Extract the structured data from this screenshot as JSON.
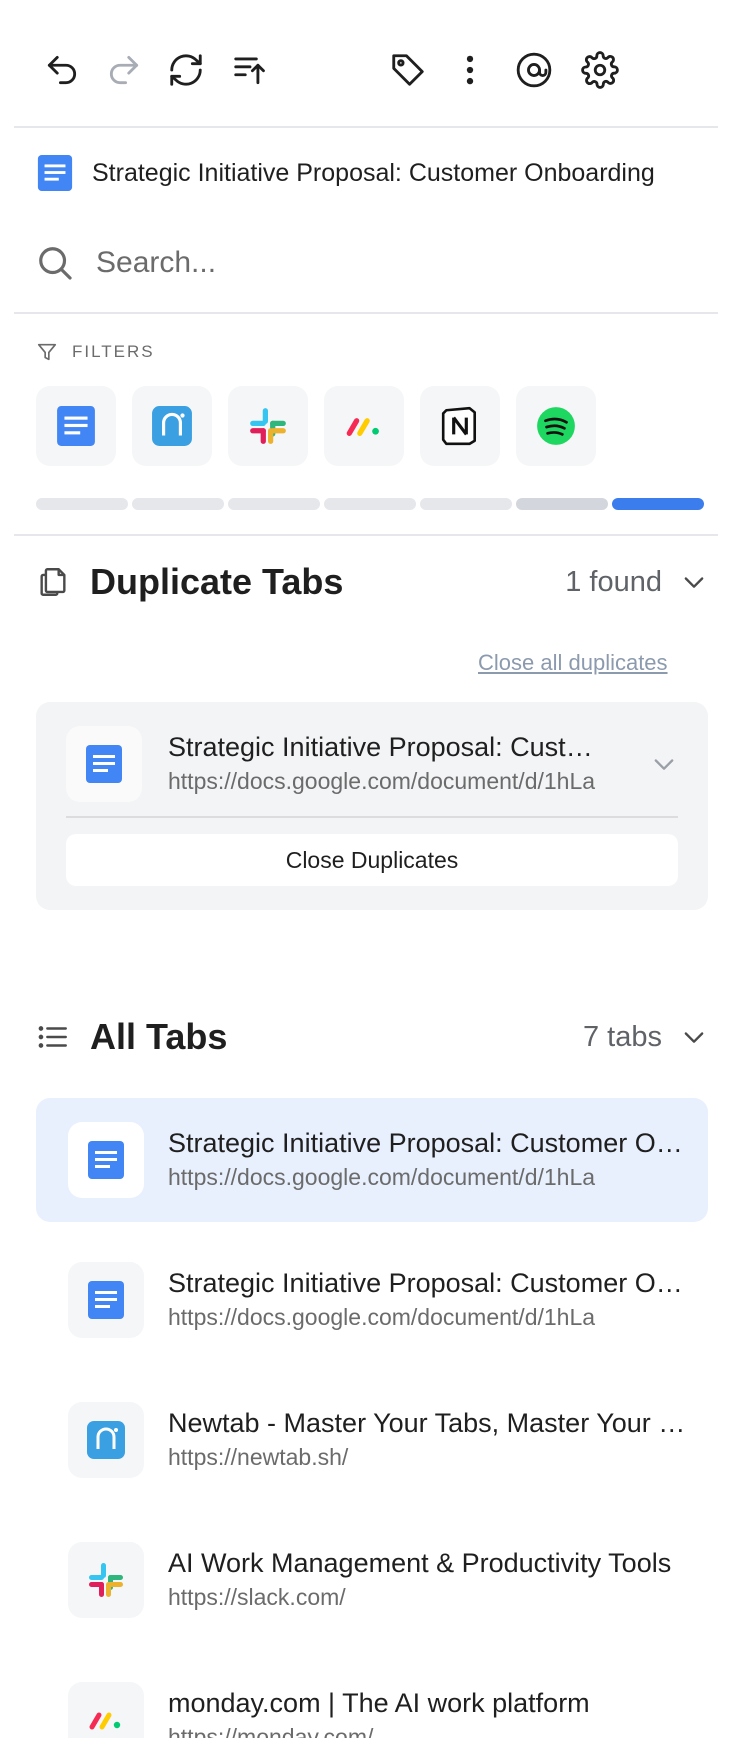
{
  "toolbar": {
    "buttons": [
      {
        "name": "undo-icon",
        "label": "Undo"
      },
      {
        "name": "redo-icon",
        "label": "Redo"
      },
      {
        "name": "refresh-icon",
        "label": "Refresh"
      },
      {
        "name": "sort-icon",
        "label": "Sort"
      },
      {
        "name": "tag-icon",
        "label": "Tags"
      },
      {
        "name": "more-vertical-icon",
        "label": "More"
      },
      {
        "name": "at-sign-icon",
        "label": "Mentions"
      },
      {
        "name": "gear-icon",
        "label": "Settings"
      }
    ]
  },
  "current_tab": {
    "title": "Strategic Initiative Proposal: Customer Onboarding",
    "icon": "google-docs-icon"
  },
  "search": {
    "placeholder": "Search...",
    "value": ""
  },
  "filters": {
    "label": "FILTERS",
    "chips": [
      {
        "icon": "google-docs-icon"
      },
      {
        "icon": "newtab-icon"
      },
      {
        "icon": "slack-icon"
      },
      {
        "icon": "monday-icon"
      },
      {
        "icon": "notion-icon"
      },
      {
        "icon": "spotify-icon"
      }
    ],
    "progress_segments": 7,
    "active_segment": 7,
    "colors": {
      "inactive": "#e5e7eb",
      "secondary": "#d3d6dc",
      "active": "#3b7ded"
    }
  },
  "duplicates": {
    "title": "Duplicate Tabs",
    "count": "1 found",
    "close_all_label": "Close all duplicates",
    "items": [
      {
        "title": "Strategic Initiative Proposal: Customer Onboarding",
        "url": "https://docs.google.com/document/d/1hLa",
        "icon": "google-docs-icon",
        "close_label": "Close Duplicates"
      }
    ]
  },
  "all_tabs": {
    "title": "All Tabs",
    "count": "7 tabs",
    "items": [
      {
        "title": "Strategic Initiative Proposal: Customer Onboarding",
        "url": "https://docs.google.com/document/d/1hLa",
        "icon": "google-docs-icon",
        "active": true
      },
      {
        "title": "Strategic Initiative Proposal: Customer Onboarding",
        "url": "https://docs.google.com/document/d/1hLa",
        "icon": "google-docs-icon",
        "active": false
      },
      {
        "title": "Newtab - Master Your Tabs, Master Your Focus",
        "url": "https://newtab.sh/",
        "icon": "newtab-icon",
        "active": false
      },
      {
        "title": "AI Work Management & Productivity Tools",
        "url": "https://slack.com/",
        "icon": "slack-icon",
        "active": false
      },
      {
        "title": "monday.com | The AI work platform",
        "url": "https://monday.com/",
        "icon": "monday-icon",
        "active": false
      }
    ]
  },
  "colors": {
    "accent": "#3b7ded",
    "active_row": "#e8f0fe",
    "card": "#f3f4f6",
    "muted_text": "#6b6b6b",
    "link": "#8c9aae"
  }
}
